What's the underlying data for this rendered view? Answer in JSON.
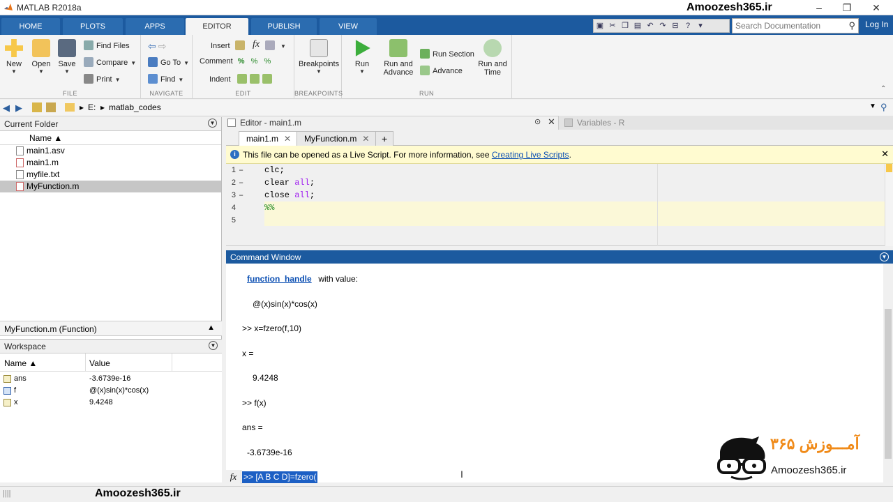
{
  "window": {
    "title": "MATLAB R2018a",
    "watermark": "Amoozesh365.ir",
    "minimize": "–",
    "restore": "❐",
    "close": "✕"
  },
  "ribbon_tabs": [
    "HOME",
    "PLOTS",
    "APPS",
    "EDITOR",
    "PUBLISH",
    "VIEW"
  ],
  "active_tab": "EDITOR",
  "search": {
    "placeholder": "Search Documentation",
    "icon": "search-icon"
  },
  "login": "Log In",
  "ribbon": {
    "file": {
      "label": "FILE",
      "new": "New",
      "open": "Open",
      "save": "Save",
      "find_files": "Find Files",
      "compare": "Compare",
      "print": "Print"
    },
    "navigate": {
      "label": "NAVIGATE",
      "go_to": "Go To",
      "find": "Find"
    },
    "edit": {
      "label": "EDIT",
      "insert": "Insert",
      "comment": "Comment",
      "indent": "Indent",
      "fx": "fx"
    },
    "breakpoints": {
      "label": "BREAKPOINTS",
      "breakpoints": "Breakpoints"
    },
    "run": {
      "label": "RUN",
      "run": "Run",
      "run_and_advance_1": "Run and",
      "run_and_advance_2": "Advance",
      "run_section": "Run Section",
      "advance": "Advance",
      "run_and_time_1": "Run and",
      "run_and_time_2": "Time"
    }
  },
  "address": {
    "drive": "E:",
    "separator": "▸",
    "folder": "matlab_codes"
  },
  "current_folder": {
    "title": "Current Folder",
    "column": "Name ▲",
    "files": [
      {
        "name": "main1.asv",
        "selected": false
      },
      {
        "name": "main1.m",
        "selected": false
      },
      {
        "name": "myfile.txt",
        "selected": false
      },
      {
        "name": "MyFunction.m",
        "selected": true
      }
    ]
  },
  "details": {
    "text": "MyFunction.m  (Function)",
    "toggle": "▲"
  },
  "workspace": {
    "title": "Workspace",
    "col_name": "Name ▲",
    "col_value": "Value",
    "vars": [
      {
        "name": "ans",
        "value": "-3.6739e-16"
      },
      {
        "name": "f",
        "value": "@(x)sin(x)*cos(x)"
      },
      {
        "name": "x",
        "value": "9.4248"
      }
    ]
  },
  "editor": {
    "header": "Editor - main1.m",
    "variables_header": "Variables - R",
    "tabs": [
      "main1.m",
      "MyFunction.m"
    ],
    "active_tab": "main1.m",
    "add_tab": "+",
    "info": "This file can be opened as a Live Script. For more information, see ",
    "info_link": "Creating Live Scripts",
    "info_end": ".",
    "lines": [
      {
        "n": "1",
        "dash": "–",
        "code": "clc;",
        "kw": "",
        "end": ""
      },
      {
        "n": "2",
        "dash": "–",
        "code": "clear ",
        "kw": "all",
        "end": ";"
      },
      {
        "n": "3",
        "dash": "–",
        "code": "close ",
        "kw": "all",
        "end": ";"
      },
      {
        "n": "4",
        "dash": "",
        "code": "",
        "kw": "",
        "end": "",
        "comment": "%%"
      },
      {
        "n": "5",
        "dash": "",
        "code": "",
        "kw": "",
        "end": ""
      }
    ]
  },
  "command_window": {
    "title": "Command Window",
    "output": {
      "handle_link": "function_handle",
      "handle_rest": " with value:",
      "handle_val": "@(x)sin(x)*cos(x)",
      "cmd1": ">> x=fzero(f,10)",
      "x_label": "x =",
      "x_val": "9.4248",
      "cmd2": ">> f(x)",
      "ans_label": "ans =",
      "ans_val": "-3.6739e-16"
    },
    "prompt_icon": "fx",
    "current_input": ">> [A B C D]=fzero("
  },
  "logo": {
    "brand": "آمـــوزش ۳۶۵",
    "url": "Amoozesh365.ir"
  },
  "status": {
    "grip": "||||",
    "watermark": "Amoozesh365.ir"
  },
  "colors": {
    "accent": "#1c5a9f",
    "selection": "#1c5fc4",
    "info_bar": "#fffbd0",
    "keyword": "#a020f0",
    "comment": "#228b22",
    "logo_orange": "#f08a18"
  }
}
